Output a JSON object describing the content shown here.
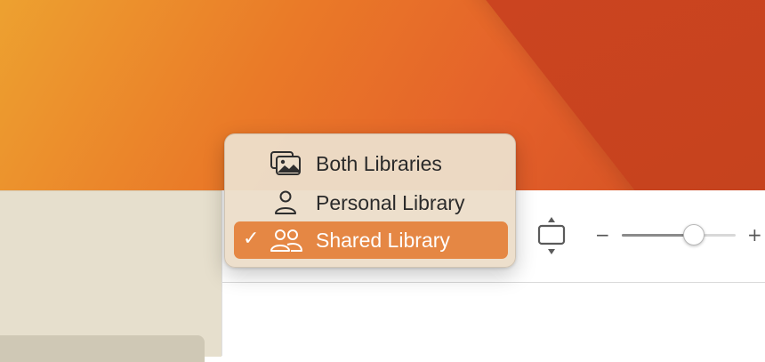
{
  "colors": {
    "menu_selection": "#e58744",
    "wallpaper_primary": "#ea7a28",
    "sidebar_bg": "#e6dfcd"
  },
  "library_menu": {
    "items": [
      {
        "label": "Both Libraries",
        "icon": "photo-stack-icon",
        "selected": false
      },
      {
        "label": "Personal Library",
        "icon": "person-icon",
        "selected": false
      },
      {
        "label": "Shared Library",
        "icon": "two-people-icon",
        "selected": true
      }
    ],
    "check_glyph": "✓"
  },
  "toolbar": {
    "zoom_minus": "−",
    "zoom_plus": "+",
    "zoom_level": 0.63,
    "fit_icon": "fit-to-window-icon"
  }
}
